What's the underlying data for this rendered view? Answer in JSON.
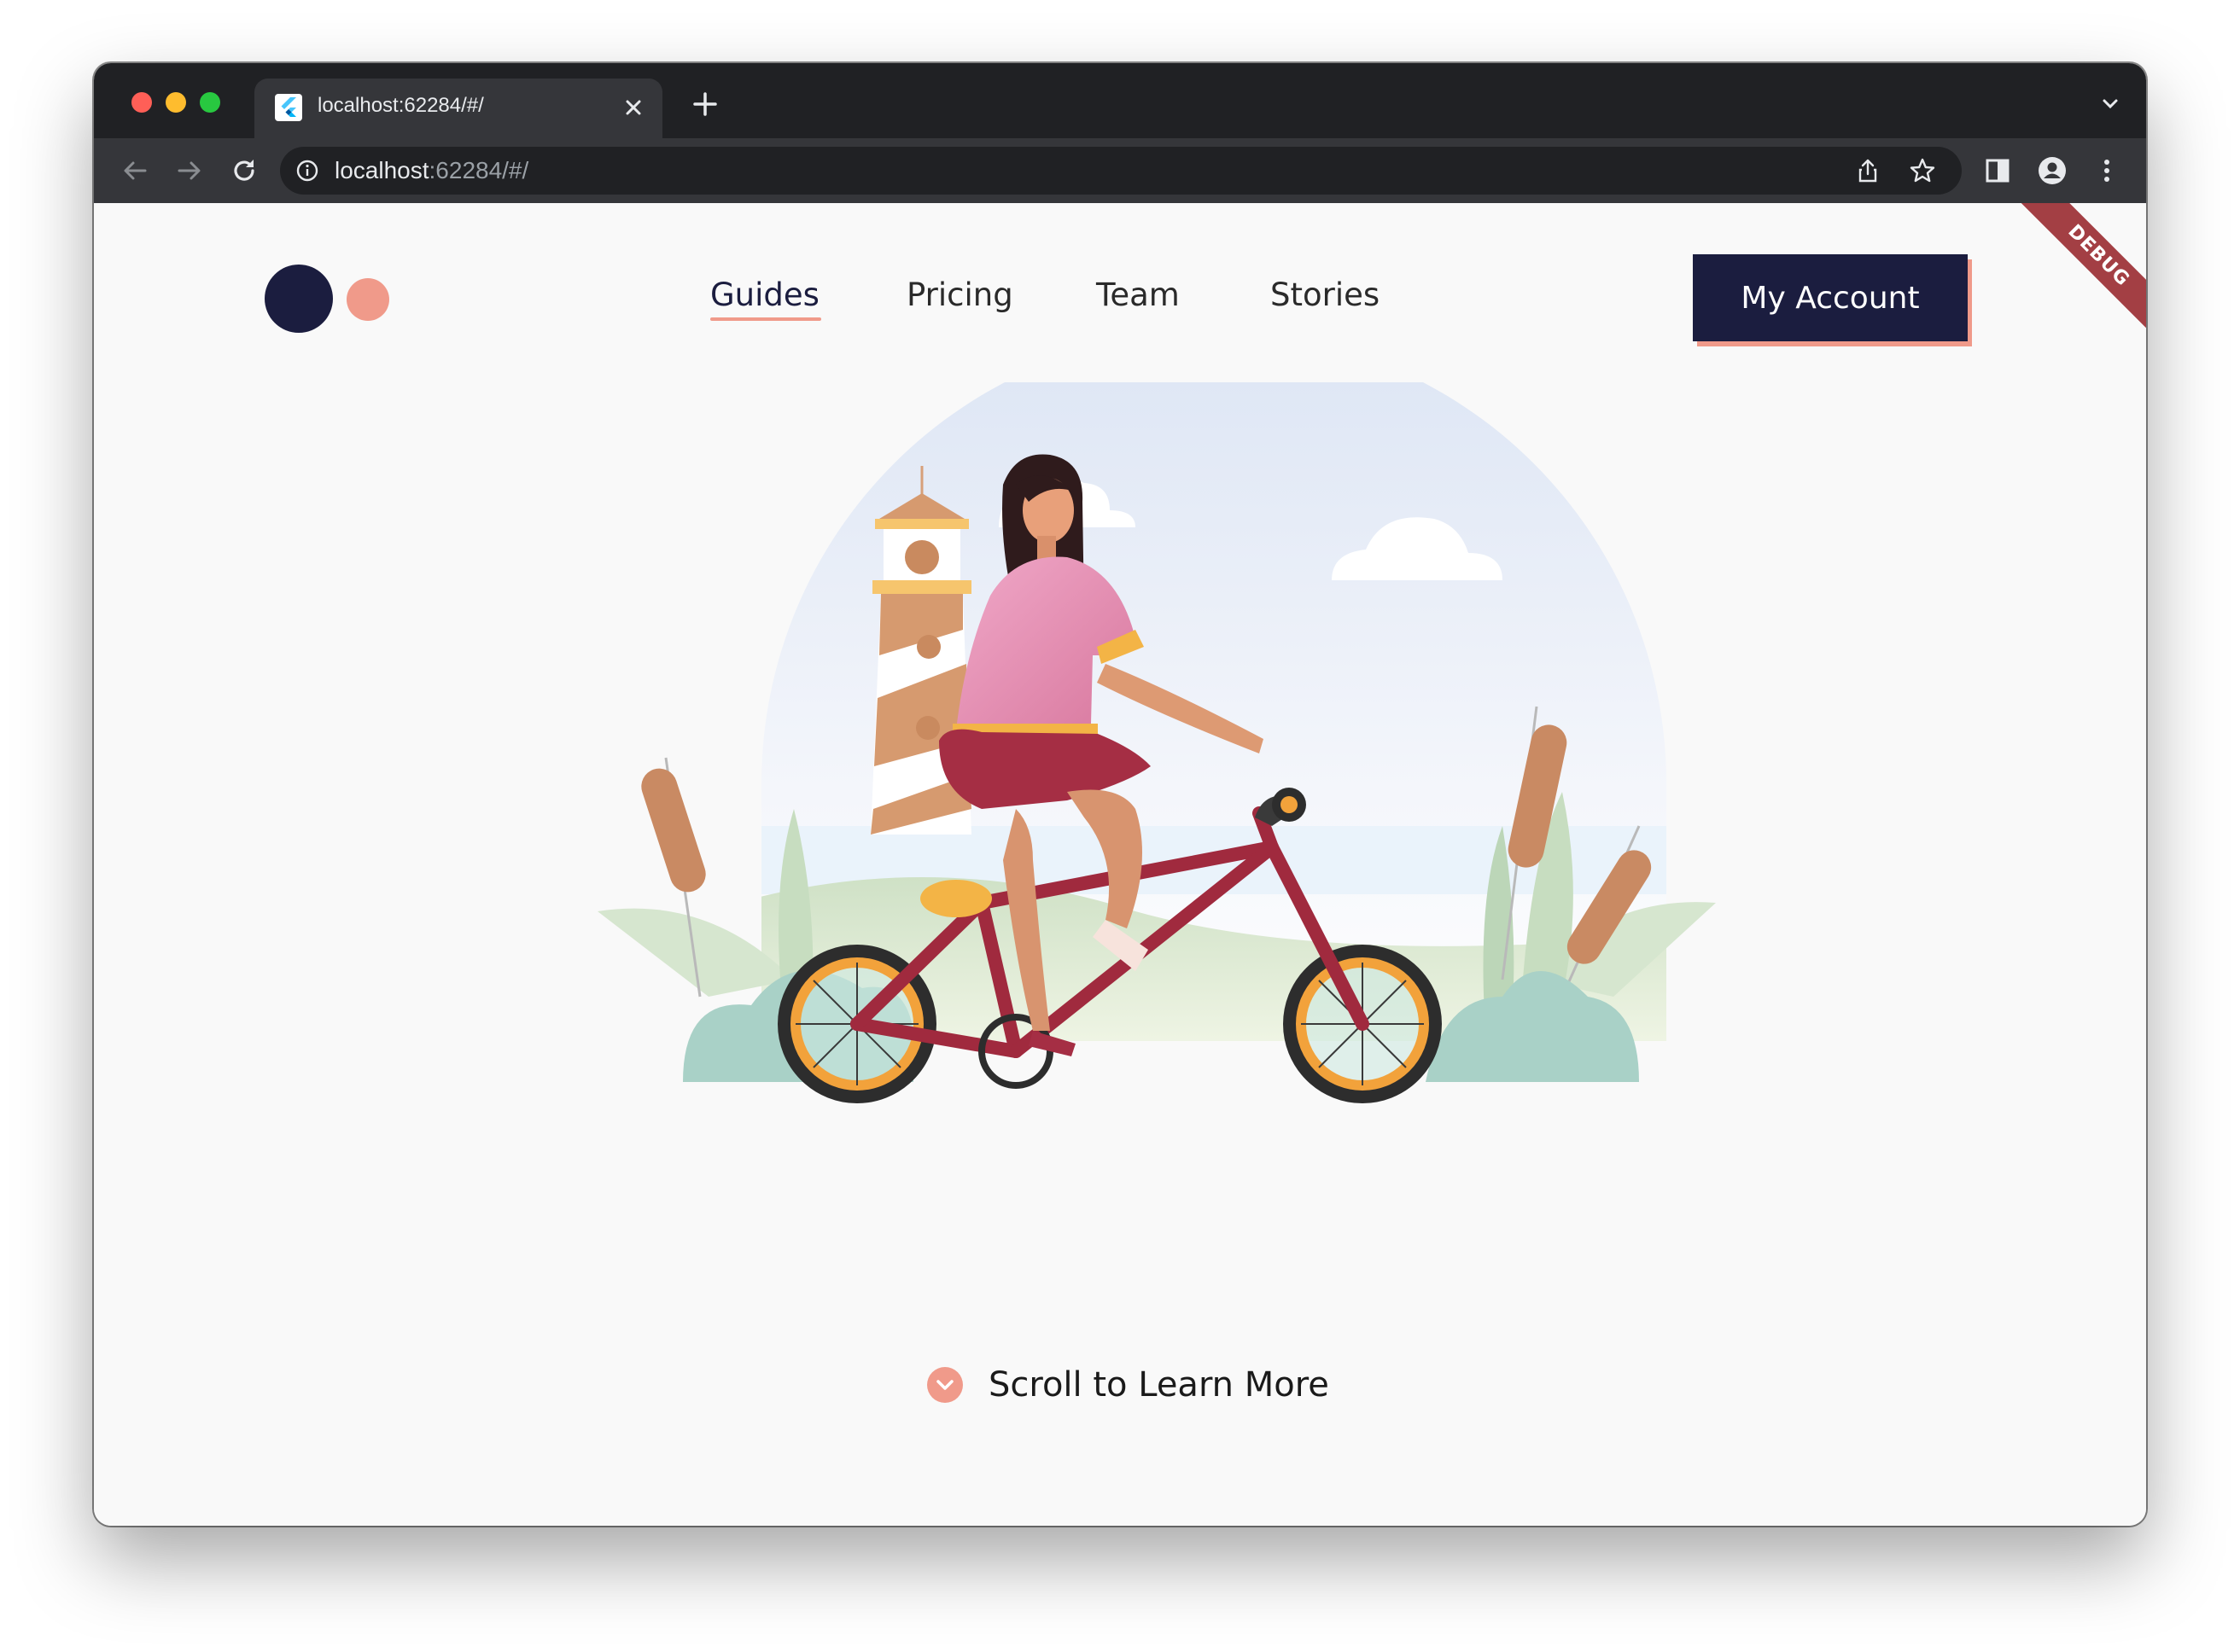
{
  "browser": {
    "tab_title": "localhost:62284/#/",
    "url_host": "localhost",
    "url_rest": ":62284/#/"
  },
  "app": {
    "nav": [
      "Guides",
      "Pricing",
      "Team",
      "Stories"
    ],
    "active_nav": "Guides",
    "account_button": "My Account",
    "debug_banner": "DEBUG",
    "scroll_cta": "Scroll to Learn More"
  },
  "colors": {
    "navy": "#1b1d3f",
    "accent_pink": "#f09a8a",
    "background": "#f9f9f9",
    "debug_red": "#a33f44"
  },
  "icons": [
    "back-arrow-icon",
    "forward-arrow-icon",
    "reload-icon",
    "info-icon",
    "share-icon",
    "star-icon",
    "side-panel-icon",
    "profile-icon",
    "kebab-menu-icon",
    "chevron-down-icon",
    "plus-icon",
    "close-icon",
    "flutter-favicon"
  ]
}
